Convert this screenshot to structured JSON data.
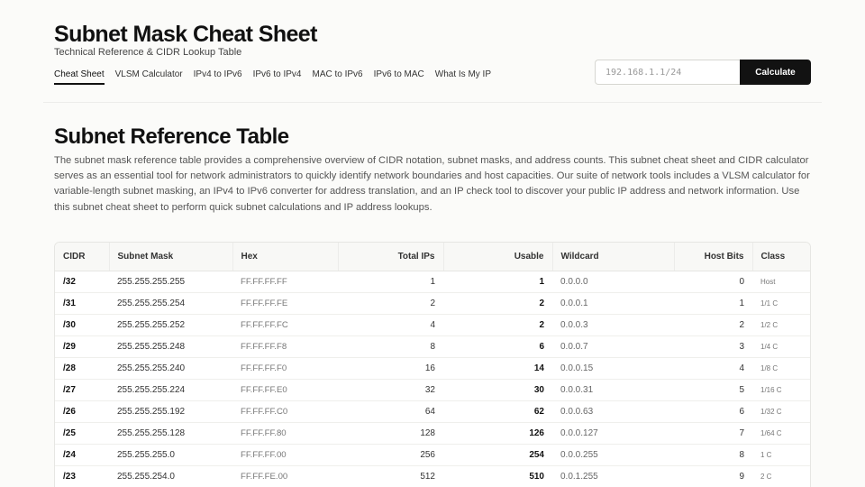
{
  "header": {
    "title": "Subnet Mask Cheat Sheet",
    "subtitle": "Technical Reference & CIDR Lookup Table",
    "nav": [
      {
        "label": "Cheat Sheet",
        "active": true
      },
      {
        "label": "VLSM Calculator"
      },
      {
        "label": "IPv4 to IPv6"
      },
      {
        "label": "IPv6 to IPv4"
      },
      {
        "label": "MAC to IPv6"
      },
      {
        "label": "IPv6 to MAC"
      },
      {
        "label": "What Is My IP"
      }
    ],
    "search": {
      "placeholder": "192.168.1.1/24",
      "value": "",
      "button_label": "Calculate"
    }
  },
  "main": {
    "title": "Subnet Reference Table",
    "description": "The subnet mask reference table provides a comprehensive overview of CIDR notation, subnet masks, and address counts. This subnet cheat sheet and CIDR calculator serves as an essential tool for network administrators to quickly identify network boundaries and host capacities. Our suite of network tools includes a VLSM calculator for variable-length subnet masking, an IPv4 to IPv6 converter for address translation, and an IP check tool to discover your public IP address and network information. Use this subnet cheat sheet to perform quick subnet calculations and IP address lookups."
  },
  "table": {
    "columns": [
      "CIDR",
      "Subnet Mask",
      "Hex",
      "Total IPs",
      "Usable",
      "Wildcard",
      "Host Bits",
      "Class"
    ],
    "rows": [
      [
        "/32",
        "255.255.255.255",
        "FF.FF.FF.FF",
        "1",
        "1",
        "0.0.0.0",
        "0",
        "Host"
      ],
      [
        "/31",
        "255.255.255.254",
        "FF.FF.FF.FE",
        "2",
        "2",
        "0.0.0.1",
        "1",
        "1/1 C"
      ],
      [
        "/30",
        "255.255.255.252",
        "FF.FF.FF.FC",
        "4",
        "2",
        "0.0.0.3",
        "2",
        "1/2 C"
      ],
      [
        "/29",
        "255.255.255.248",
        "FF.FF.FF.F8",
        "8",
        "6",
        "0.0.0.7",
        "3",
        "1/4 C"
      ],
      [
        "/28",
        "255.255.255.240",
        "FF.FF.FF.F0",
        "16",
        "14",
        "0.0.0.15",
        "4",
        "1/8 C"
      ],
      [
        "/27",
        "255.255.255.224",
        "FF.FF.FF.E0",
        "32",
        "30",
        "0.0.0.31",
        "5",
        "1/16 C"
      ],
      [
        "/26",
        "255.255.255.192",
        "FF.FF.FF.C0",
        "64",
        "62",
        "0.0.0.63",
        "6",
        "1/32 C"
      ],
      [
        "/25",
        "255.255.255.128",
        "FF.FF.FF.80",
        "128",
        "126",
        "0.0.0.127",
        "7",
        "1/64 C"
      ],
      [
        "/24",
        "255.255.255.0",
        "FF.FF.FF.00",
        "256",
        "254",
        "0.0.0.255",
        "8",
        "1 C"
      ],
      [
        "/23",
        "255.255.254.0",
        "FF.FF.FE.00",
        "512",
        "510",
        "0.0.1.255",
        "9",
        "2 C"
      ]
    ]
  }
}
